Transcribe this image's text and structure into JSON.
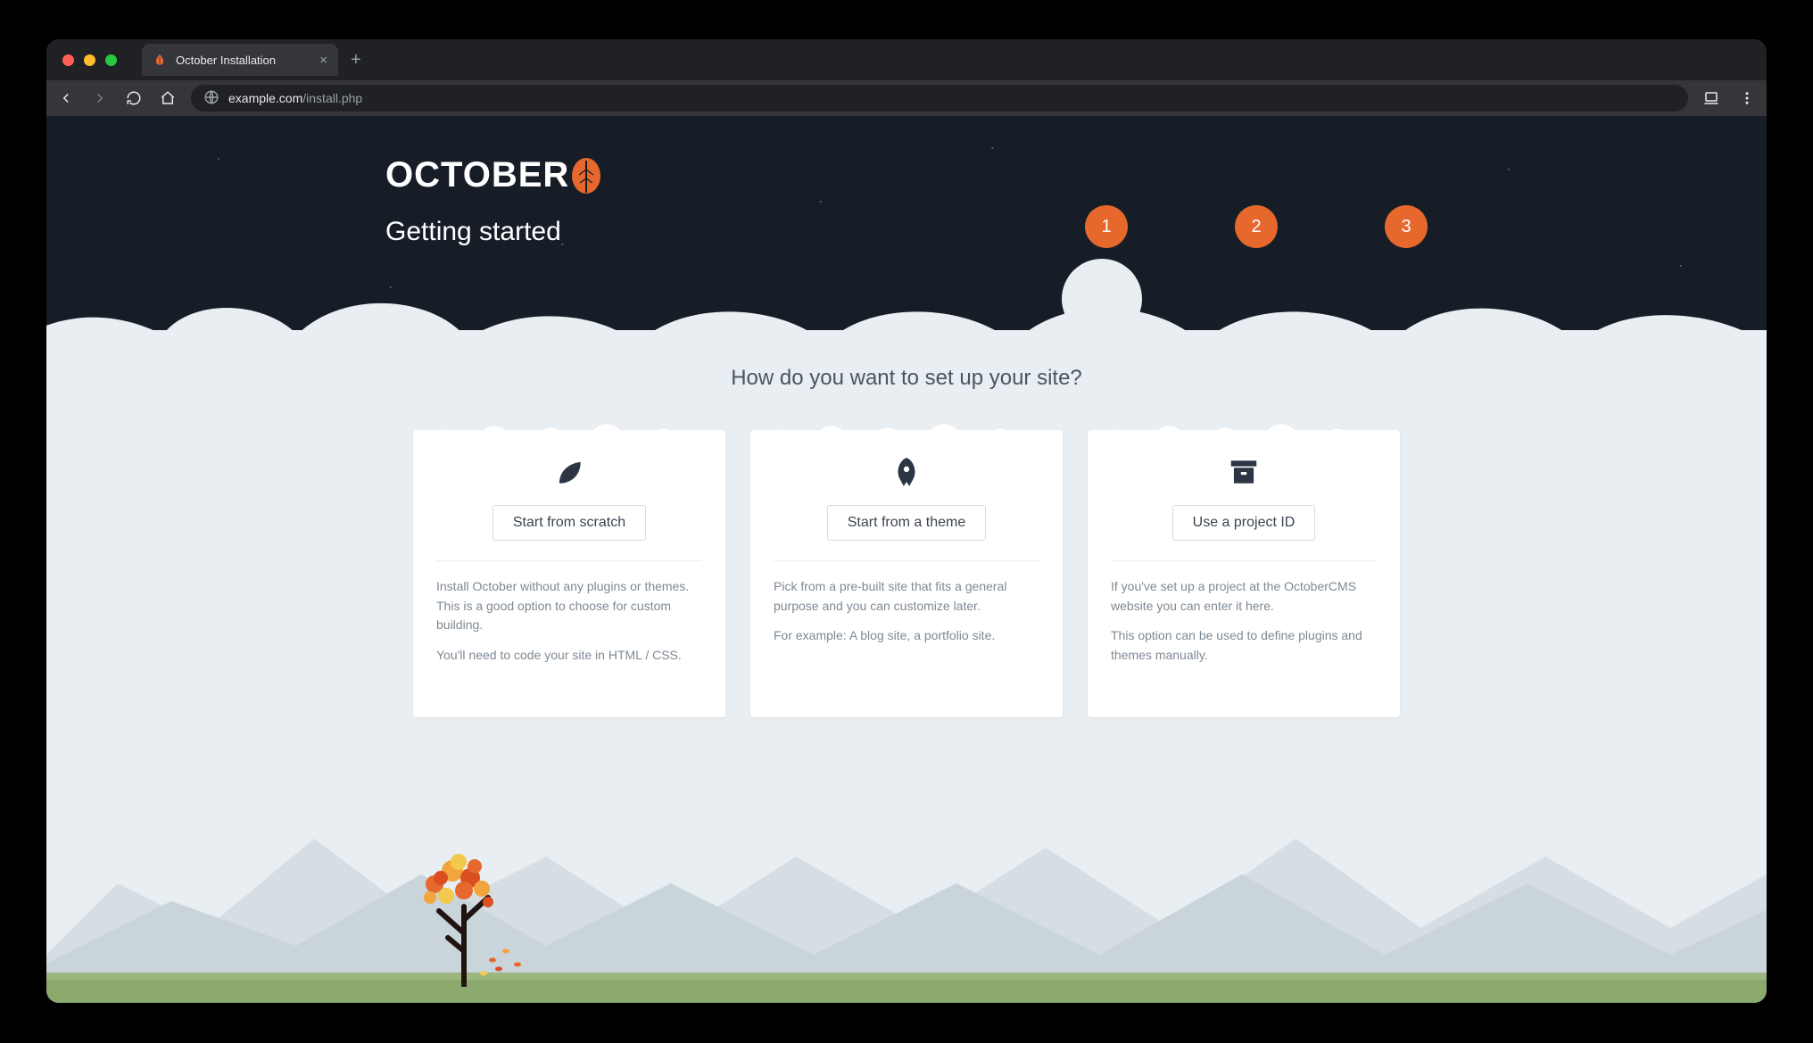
{
  "browser": {
    "tab_title": "October Installation",
    "url_host": "example.com",
    "url_path": "/install.php"
  },
  "header": {
    "brand": "OCTOBER",
    "heading": "Getting started",
    "steps": [
      "1",
      "2",
      "3"
    ]
  },
  "main": {
    "question": "How do you want to set up your site?",
    "cards": [
      {
        "icon": "leaf",
        "button": "Start from scratch",
        "p1": "Install October without any plugins or themes. This is a good option to choose for custom building.",
        "p2": "You'll need to code your site in HTML / CSS."
      },
      {
        "icon": "rocket",
        "button": "Start from a theme",
        "p1": "Pick from a pre-built site that fits a general purpose and you can customize later.",
        "p2": "For example: A blog site, a portfolio site."
      },
      {
        "icon": "archive",
        "button": "Use a project ID",
        "p1": "If you've set up a project at the OctoberCMS website you can enter it here.",
        "p2": "This option can be used to define plugins and themes manually."
      }
    ]
  }
}
